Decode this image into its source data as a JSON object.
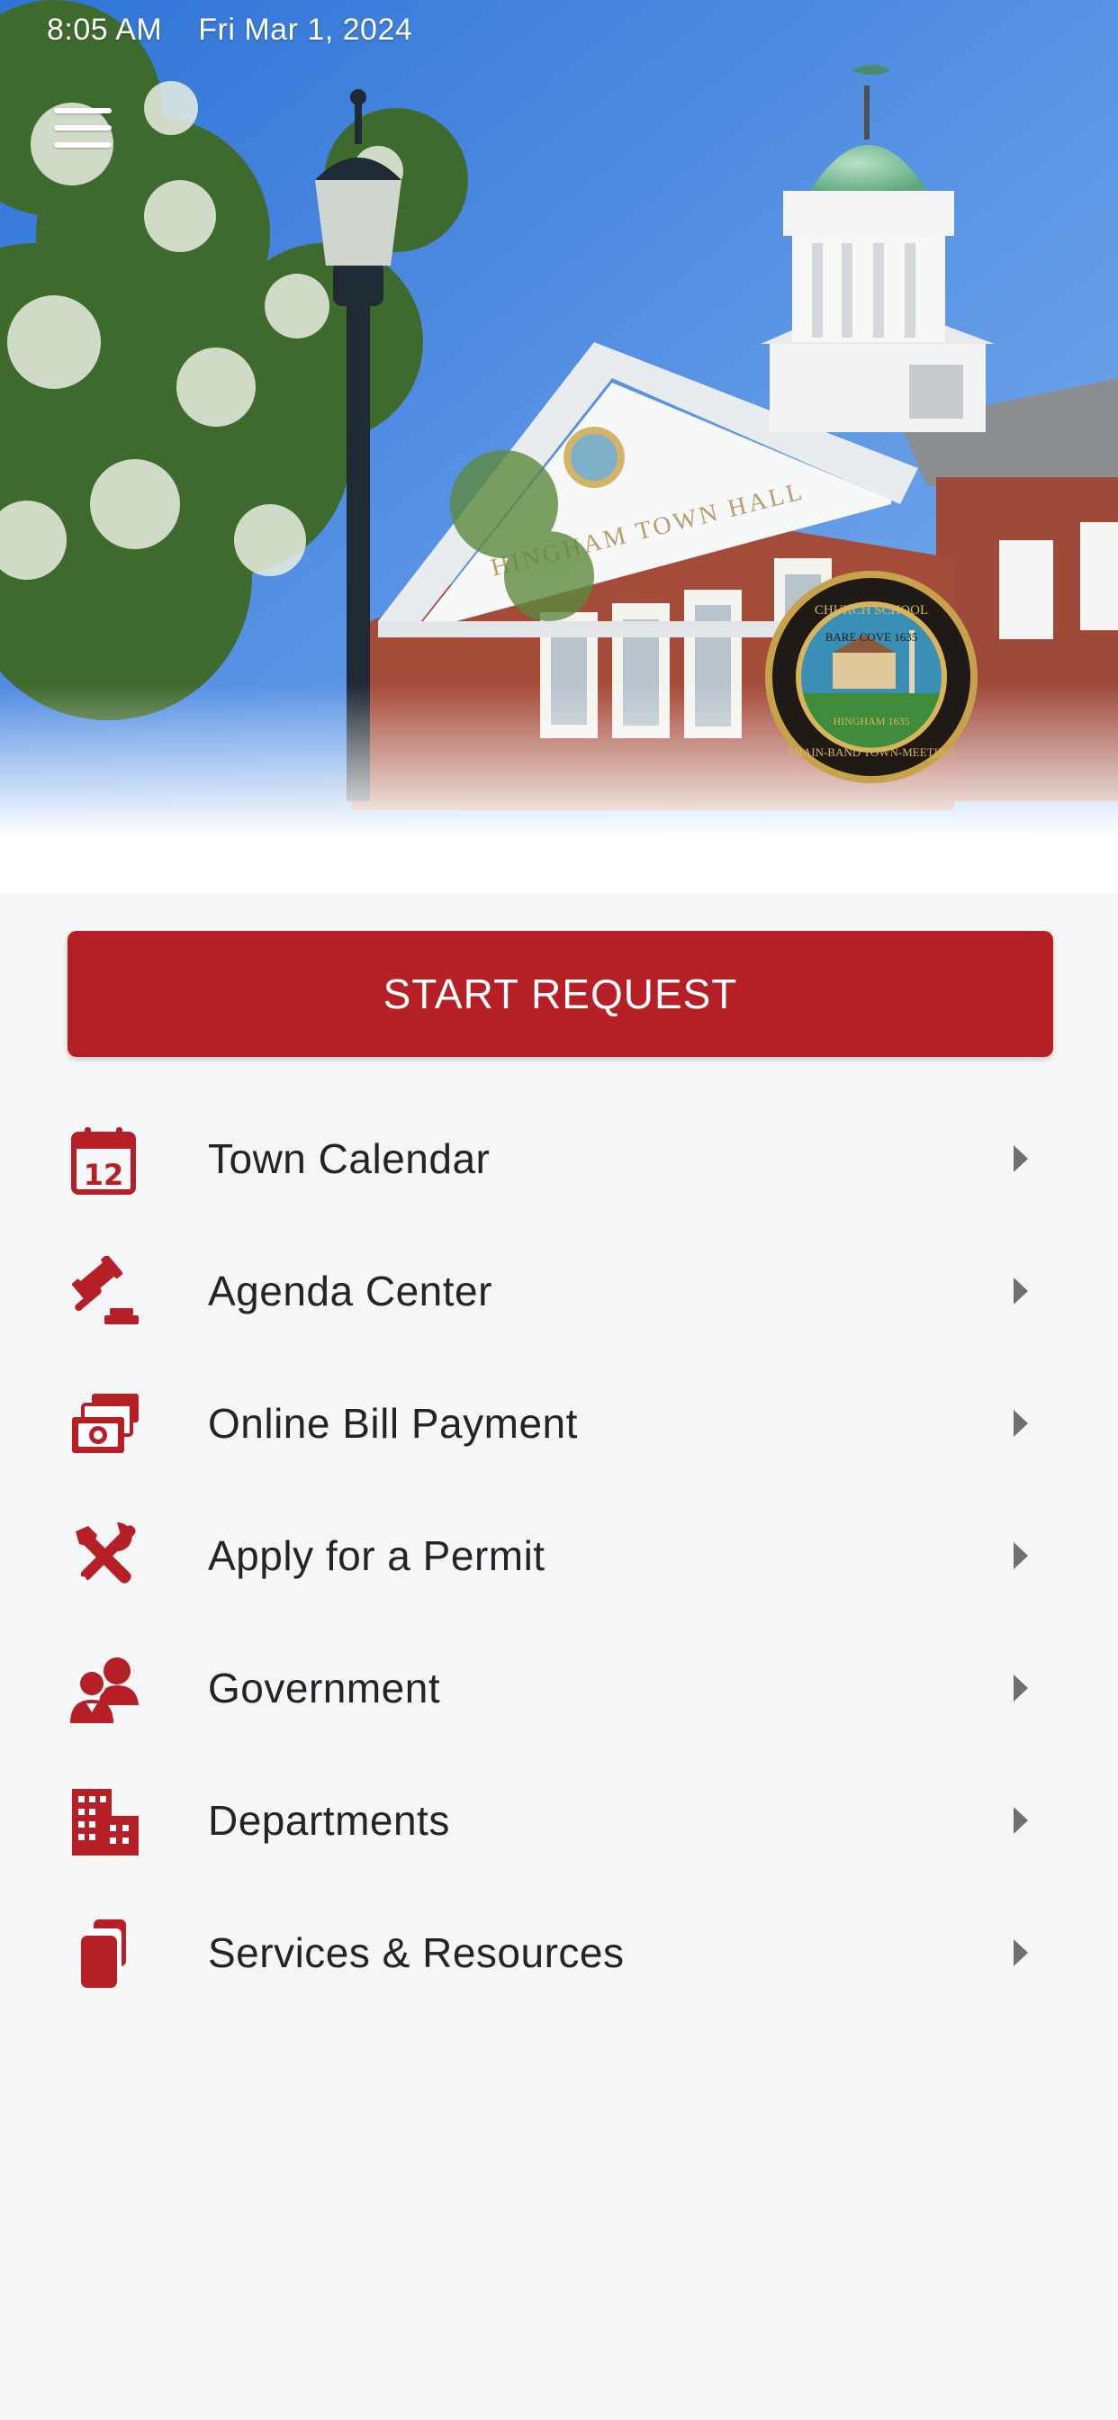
{
  "status_bar": {
    "time": "8:05 AM",
    "date": "Fri Mar 1, 2024"
  },
  "header": {
    "menu_icon": "hamburger-icon",
    "building_inscription": "HINGHAM TOWN HALL",
    "seal": {
      "top_text": "CHURCH    SCHOOL",
      "inner_text": "BARE COVE 1635",
      "band_text": "HINGHAM 1635",
      "bottom_text": "TRAIN-BAND   TOWN-MEETING"
    }
  },
  "start_request": {
    "label": "START REQUEST"
  },
  "menu": [
    {
      "label": "Town Calendar",
      "icon": "calendar-icon",
      "icon_text": "12"
    },
    {
      "label": "Agenda Center",
      "icon": "gavel-icon"
    },
    {
      "label": "Online Bill Payment",
      "icon": "money-icon"
    },
    {
      "label": "Apply for a Permit",
      "icon": "tools-icon"
    },
    {
      "label": "Government",
      "icon": "users-icon"
    },
    {
      "label": "Departments",
      "icon": "building-icon"
    },
    {
      "label": "Services & Resources",
      "icon": "documents-icon"
    }
  ],
  "colors": {
    "accent": "#b51f25",
    "background": "#f5f6f8",
    "text": "#222426",
    "chevron": "#707070"
  }
}
